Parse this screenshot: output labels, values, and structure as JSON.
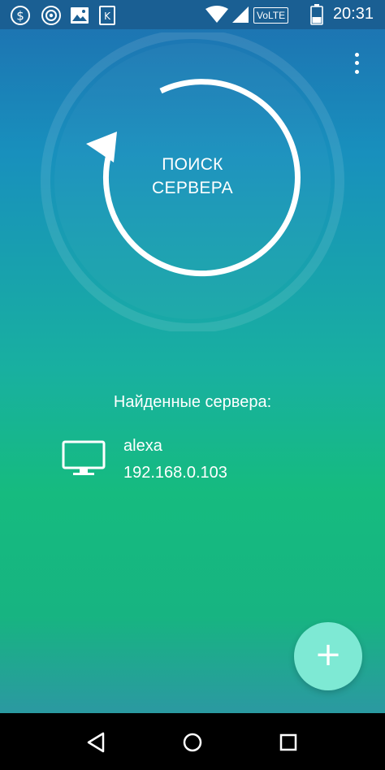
{
  "status_bar": {
    "time": "20:31",
    "volte_label": "VoLTE",
    "left_icons": [
      "dollar-coin-icon",
      "target-icon",
      "image-icon",
      "k-app-icon"
    ],
    "right_icons": [
      "wifi-icon",
      "signal-icon",
      "volte-icon",
      "battery-icon"
    ]
  },
  "search": {
    "label": "ПОИСК\nСЕРВЕРА"
  },
  "servers_section": {
    "title": "Найденные сервера:",
    "servers": [
      {
        "name": "alexa",
        "ip": "192.168.0.103"
      }
    ]
  },
  "fab": {
    "label": "+"
  },
  "nav_bar": {
    "icons": [
      "back-icon",
      "home-icon",
      "recents-icon"
    ]
  },
  "colors": {
    "status_bar": "#1a5f93",
    "gradient_top": "#1e6fb0",
    "gradient_mid": "#18b0a0",
    "gradient_bottom": "#16bb7f",
    "fab": "#7ee9d4",
    "nav_bar": "#000000"
  }
}
